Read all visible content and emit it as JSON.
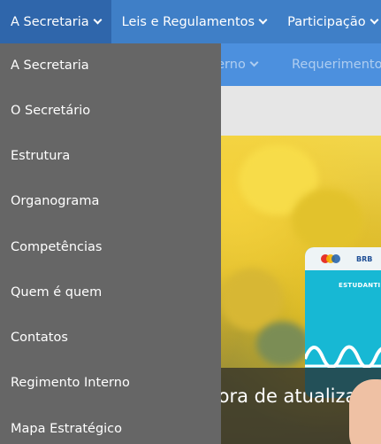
{
  "topnav": {
    "items": [
      {
        "label": "A Secretaria"
      },
      {
        "label": "Leis e Regulamentos"
      },
      {
        "label": "Participação"
      }
    ]
  },
  "subnav": {
    "items": [
      {
        "label": "Regimento Interno"
      },
      {
        "label": "Requerimentos"
      }
    ]
  },
  "dropdown": {
    "items": [
      {
        "label": "A Secretaria"
      },
      {
        "label": "O Secretário"
      },
      {
        "label": "Estrutura"
      },
      {
        "label": "Organograma"
      },
      {
        "label": "Competências"
      },
      {
        "label": "Quem é quem"
      },
      {
        "label": "Contatos"
      },
      {
        "label": "Regimento Interno"
      },
      {
        "label": "Mapa Estratégico"
      }
    ]
  },
  "hero": {
    "caption": "Cartão Estudantil: é hora de atualizar",
    "card": {
      "brand": "BRB",
      "type": "ESTUDANTIL"
    }
  },
  "colors": {
    "nav_blue": "#3f7fc7",
    "nav_active": "#2f66ab",
    "subnav_blue": "#4c90de",
    "dropdown_grey": "#666666"
  }
}
